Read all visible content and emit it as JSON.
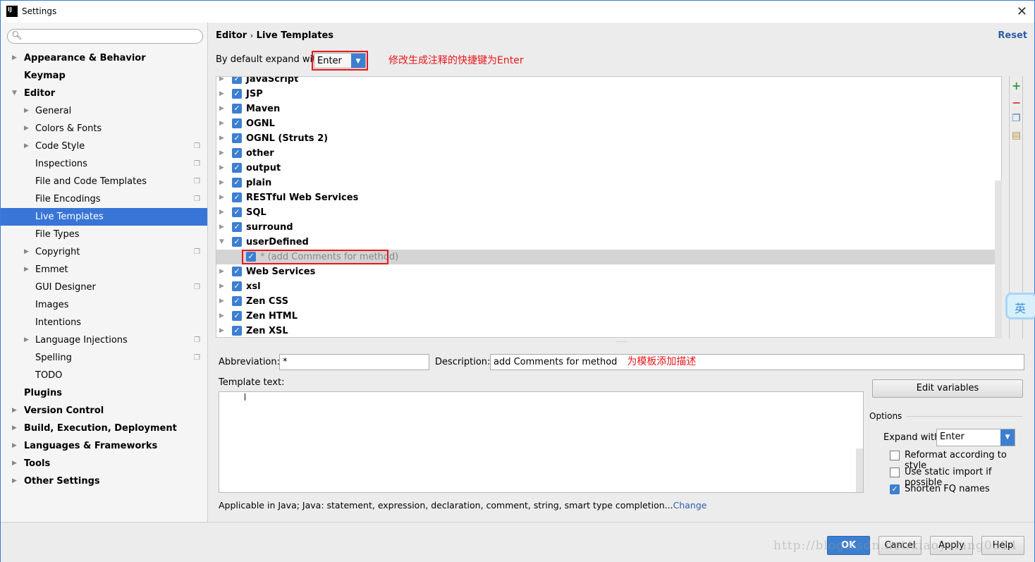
{
  "window": {
    "title": "Settings",
    "app_icon": "IJ"
  },
  "sidebar": {
    "items": [
      {
        "label": "Appearance & Behavior",
        "bold": true,
        "level": 0,
        "arrow": "right"
      },
      {
        "label": "Keymap",
        "bold": true,
        "level": 0
      },
      {
        "label": "Editor",
        "bold": true,
        "level": 0,
        "arrow": "down"
      },
      {
        "label": "General",
        "level": 1,
        "arrow": "right"
      },
      {
        "label": "Colors & Fonts",
        "level": 1,
        "arrow": "right"
      },
      {
        "label": "Code Style",
        "level": 1,
        "arrow": "right",
        "copy": true
      },
      {
        "label": "Inspections",
        "level": 1,
        "copy": true
      },
      {
        "label": "File and Code Templates",
        "level": 1,
        "copy": true
      },
      {
        "label": "File Encodings",
        "level": 1,
        "copy": true
      },
      {
        "label": "Live Templates",
        "level": 1,
        "selected": true
      },
      {
        "label": "File Types",
        "level": 1
      },
      {
        "label": "Copyright",
        "level": 1,
        "arrow": "right",
        "copy": true
      },
      {
        "label": "Emmet",
        "level": 1,
        "arrow": "right"
      },
      {
        "label": "GUI Designer",
        "level": 1,
        "copy": true
      },
      {
        "label": "Images",
        "level": 1
      },
      {
        "label": "Intentions",
        "level": 1
      },
      {
        "label": "Language Injections",
        "level": 1,
        "arrow": "right",
        "copy": true
      },
      {
        "label": "Spelling",
        "level": 1,
        "copy": true
      },
      {
        "label": "TODO",
        "level": 1
      },
      {
        "label": "Plugins",
        "bold": true,
        "level": 0
      },
      {
        "label": "Version Control",
        "bold": true,
        "level": 0,
        "arrow": "right"
      },
      {
        "label": "Build, Execution, Deployment",
        "bold": true,
        "level": 0,
        "arrow": "right"
      },
      {
        "label": "Languages & Frameworks",
        "bold": true,
        "level": 0,
        "arrow": "right"
      },
      {
        "label": "Tools",
        "bold": true,
        "level": 0,
        "arrow": "right"
      },
      {
        "label": "Other Settings",
        "bold": true,
        "level": 0,
        "arrow": "right"
      }
    ]
  },
  "header": {
    "crumb1": "Editor",
    "sep": "›",
    "crumb2": "Live Templates",
    "reset": "Reset"
  },
  "expand": {
    "label": "By default expand with",
    "value": "Enter",
    "note": "修改生成注释的快捷键为Enter"
  },
  "tree": [
    {
      "label": "JavaScript"
    },
    {
      "label": "JSP"
    },
    {
      "label": "Maven"
    },
    {
      "label": "OGNL"
    },
    {
      "label": "OGNL (Struts 2)"
    },
    {
      "label": "other"
    },
    {
      "label": "output"
    },
    {
      "label": "plain"
    },
    {
      "label": "RESTful Web Services"
    },
    {
      "label": "SQL"
    },
    {
      "label": "surround"
    },
    {
      "label": "userDefined",
      "expanded": true
    },
    {
      "label": "* (add Comments for method)",
      "child": true,
      "selected": true
    },
    {
      "label": "Web Services"
    },
    {
      "label": "xsl"
    },
    {
      "label": "Zen CSS"
    },
    {
      "label": "Zen HTML"
    },
    {
      "label": "Zen XSL"
    }
  ],
  "ime": "英",
  "form": {
    "abbr_label": "Abbreviation:",
    "abbr_value": "*",
    "desc_label": "Description:",
    "desc_value": "add Comments for method",
    "desc_note": "为模板添加描述",
    "template_label": "Template text:",
    "edit_vars": "Edit variables",
    "options_label": "Options",
    "expand_with_label": "Expand with",
    "expand_with_value": "Enter",
    "opt_reformat": "Reformat according to style",
    "opt_static": "Use static import if possible",
    "opt_shorten": "Shorten FQ names",
    "applicable": "Applicable in Java; Java: statement, expression, declaration, comment, string, smart type completion...",
    "change": "Change"
  },
  "footer": {
    "ok": "OK",
    "cancel": "Cancel",
    "apply": "Apply",
    "help": "Help",
    "watermark": "http://blog.csdn.net/xiaoyulang0824"
  },
  "colors": {
    "accent": "#3875d7",
    "annotation": "#e8161b",
    "link": "#2d5ea8"
  }
}
